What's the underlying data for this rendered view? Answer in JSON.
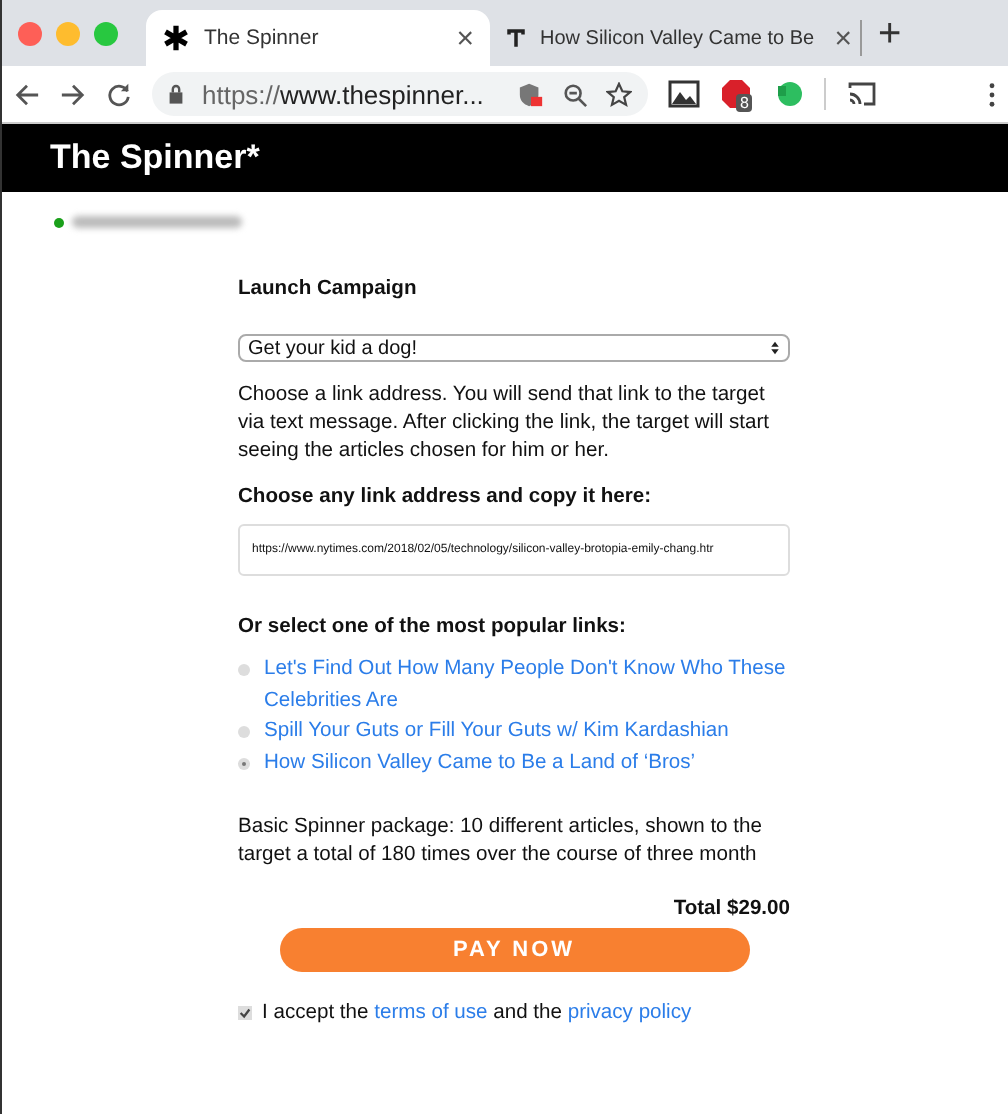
{
  "browser": {
    "tabs": [
      {
        "title": "The Spinner",
        "selected": true,
        "close": "×"
      },
      {
        "title": "How Silicon Valley Came to Be",
        "selected": false,
        "close": "×"
      }
    ],
    "new_tab": "+",
    "url": {
      "prefix": "https://",
      "host": "www.thespinner..."
    },
    "extension_badge": "8"
  },
  "site": {
    "title": "The Spinner*",
    "user_online": true
  },
  "form": {
    "heading": "Launch Campaign",
    "campaign_select": "Get your kid a dog!",
    "intro": "Choose a link address. You will send that link to the target via text message. After clicking the link, the target will start seeing the articles chosen for him or her.",
    "link_label": "Choose any link address and copy it here:",
    "link_value": "https://www.nytimes.com/2018/02/05/technology/silicon-valley-brotopia-emily-chang.htr",
    "popular_label": "Or select one of the most popular links:",
    "popular_links": [
      {
        "text": "Let's Find Out How Many People Don't Know Who These Celebrities Are",
        "selected": false
      },
      {
        "text": "Spill Your Guts or Fill Your Guts w/ Kim Kardashian",
        "selected": false
      },
      {
        "text": "How Silicon Valley Came to Be a Land of ‘Bros’",
        "selected": true
      }
    ],
    "package": "Basic Spinner package: 10 different articles, shown to the target a total of 180 times over the course of three month",
    "total": "Total $29.00",
    "pay_button": "PAY NOW",
    "terms": {
      "checked": true,
      "before": "I accept the",
      "terms_link": "terms of use",
      "middle": "and the",
      "privacy_link": "privacy policy"
    }
  }
}
